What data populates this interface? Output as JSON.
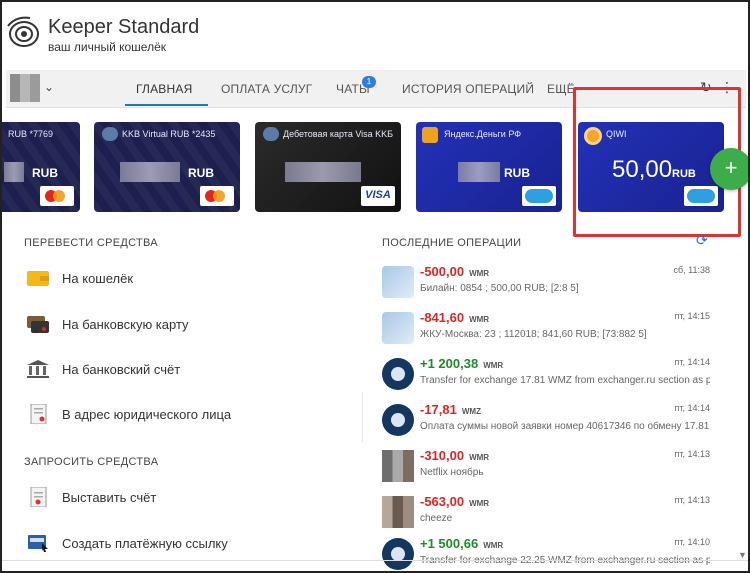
{
  "header": {
    "title": "Keeper Standard",
    "subtitle": "ваш личный кошелёк"
  },
  "nav": {
    "items": [
      {
        "label": "ГЛАВНАЯ",
        "active": true
      },
      {
        "label": "ОПЛАТА УСЛУГ"
      },
      {
        "label": "ЧАТЫ",
        "badge": "1"
      },
      {
        "label": "ИСТОРИЯ ОПЕРАЦИЙ"
      },
      {
        "label": "ЕЩЁ"
      }
    ],
    "accent": "#2b6fbf"
  },
  "cards": [
    {
      "name": "RUB *7769",
      "currency": "RUB",
      "badge": "mastercard-icon"
    },
    {
      "name": "KKB Virtual RUB *2435",
      "currency": "RUB",
      "badge": "mastercard-icon"
    },
    {
      "name": "Дебетовая карта Visa KKБ",
      "currency": "",
      "badge_text": "VISA"
    },
    {
      "name": "Яндекс.Деньги РФ",
      "currency": "RUB",
      "badge": "cloud-icon"
    },
    {
      "name": "QIWI",
      "amount": "50,00",
      "currency": "RUB",
      "badge": "cloud-icon"
    }
  ],
  "add_button": "+",
  "left": {
    "transfer_title": "ПЕРЕВЕСТИ СРЕДСТВА",
    "transfer_actions": [
      {
        "label": "На кошелёк",
        "icon": "wallet-icon"
      },
      {
        "label": "На банковскую карту",
        "icon": "bank-card-icon"
      },
      {
        "label": "На банковский счёт",
        "icon": "bank-building-icon"
      },
      {
        "label": "В адрес юридического лица",
        "icon": "document-icon"
      }
    ],
    "request_title": "ЗАПРОСИТЬ СРЕДСТВА",
    "request_actions": [
      {
        "label": "Выставить счёт",
        "icon": "invoice-icon"
      },
      {
        "label": "Создать платёжную ссылку",
        "icon": "payment-link-icon"
      }
    ]
  },
  "operations": {
    "title": "ПОСЛЕДНИЕ ОПЕРАЦИИ",
    "items": [
      {
        "amount": "-500,00",
        "currency": "WMR",
        "desc": "Билайн: 0854      ; 500,00 RUB; [2:8      5]",
        "date": "сб, 11:38",
        "kind": "neg",
        "icon": "mobile"
      },
      {
        "amount": "-841,60",
        "currency": "WMR",
        "desc": "ЖКУ-Москва: 23      ; 112018; 841,60 RUB; [73:882      5]",
        "date": "пт, 14:15",
        "kind": "neg",
        "icon": "mobile"
      },
      {
        "amount": "+1 200,38",
        "currency": "WMR",
        "desc": "Transfer for exchange 17.81 WMZ from exchanger.ru section as p...",
        "date": "пт, 14:14",
        "kind": "pos",
        "icon": "wm"
      },
      {
        "amount": "-17,81",
        "currency": "WMZ",
        "desc": "Оплата суммы новой заявки номер 40617346 по обмену 17.81 ...",
        "date": "пт, 14:14",
        "kind": "neg",
        "icon": "wm"
      },
      {
        "amount": "-310,00",
        "currency": "WMR",
        "desc": "Netflix ноябрь",
        "date": "пт, 14:13",
        "kind": "neg",
        "icon": "pix"
      },
      {
        "amount": "-563,00",
        "currency": "WMR",
        "desc": "cheeze",
        "date": "пт, 14:13",
        "kind": "neg",
        "icon": "pix2"
      },
      {
        "amount": "+1 500,66",
        "currency": "WMR",
        "desc": "Transfer for exchange 22.25 WMZ from exchanger.ru section as p...",
        "date": "пт, 14:10",
        "kind": "pos",
        "icon": "wm"
      }
    ]
  }
}
